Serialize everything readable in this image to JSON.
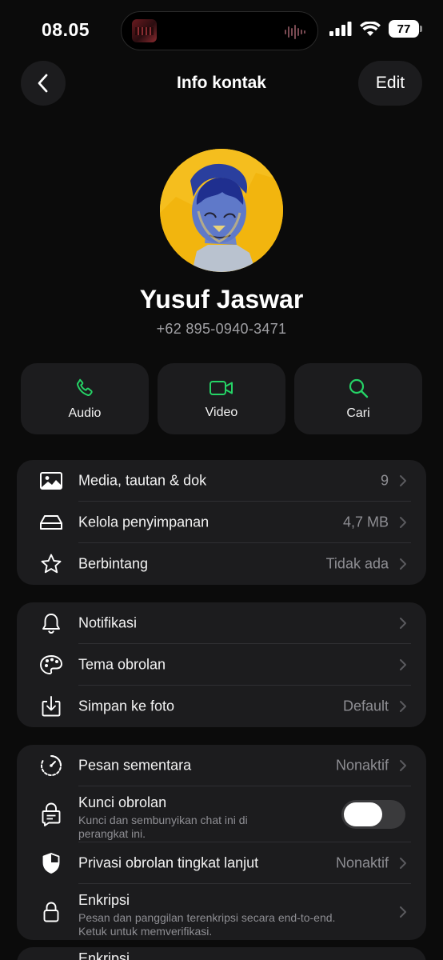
{
  "status_bar": {
    "time": "08.05",
    "battery": "77"
  },
  "nav": {
    "title": "Info kontak",
    "edit_label": "Edit"
  },
  "contact": {
    "name": "Yusuf Jaswar",
    "phone": "+62 895-0940-3471"
  },
  "actions": [
    {
      "label": "Audio",
      "icon": "phone-icon"
    },
    {
      "label": "Video",
      "icon": "video-camera-icon"
    },
    {
      "label": "Cari",
      "icon": "search-icon"
    }
  ],
  "accent_color": "#25d366",
  "group1": [
    {
      "label": "Media, tautan & dok",
      "value": "9",
      "icon": "image-icon"
    },
    {
      "label": "Kelola penyimpanan",
      "value": "4,7 MB",
      "icon": "storage-icon"
    },
    {
      "label": "Berbintang",
      "value": "Tidak ada",
      "icon": "star-icon"
    }
  ],
  "group2": [
    {
      "label": "Notifikasi",
      "value": "",
      "icon": "bell-icon"
    },
    {
      "label": "Tema obrolan",
      "value": "",
      "icon": "palette-icon"
    },
    {
      "label": "Simpan ke foto",
      "value": "Default",
      "icon": "save-to-photos-icon"
    }
  ],
  "group3": {
    "disappearing": {
      "label": "Pesan sementara",
      "value": "Nonaktif"
    },
    "chat_lock": {
      "label": "Kunci obrolan",
      "sub": "Kunci dan sembunyikan chat ini di perangkat ini.",
      "enabled": false
    },
    "advanced_privacy": {
      "label": "Privasi obrolan tingkat lanjut",
      "value": "Nonaktif"
    },
    "encryption": {
      "label": "Enkripsi",
      "sub": "Pesan dan panggilan terenkripsi secara end-to-end. Ketuk untuk memverifikasi."
    }
  },
  "peek_label": "Enkripsi"
}
